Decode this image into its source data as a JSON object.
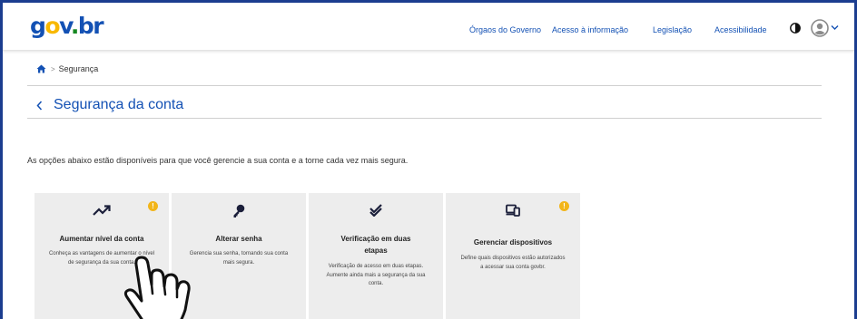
{
  "header": {
    "logo": {
      "g": "g",
      "o": "o",
      "v": "v",
      "dot": ".",
      "br": "br"
    },
    "nav": [
      {
        "label": "Órgaos do Governo"
      },
      {
        "label": "Acesso à informação"
      },
      {
        "label": "Legislação"
      },
      {
        "label": "Acessibilidade"
      }
    ],
    "icons": {
      "contrast": "contrast-icon",
      "avatar": "user-avatar-icon",
      "menu": "chevron-down-icon"
    }
  },
  "breadcrumb": {
    "current": "Segurança",
    "home_icon": "home-icon",
    "separator": ">"
  },
  "page": {
    "title": "Segurança da conta",
    "back_icon": "chevron-left-icon",
    "description": "As opções abaixo estão disponíveis para que você gerencie a sua conta e a torne cada vez mais segura."
  },
  "cards": [
    {
      "title": "Aumentar nível da conta",
      "description": "Conheça as vantagens de aumentar o nível de segurança da sua conta.",
      "icon": "trending-up-icon",
      "badge": "!"
    },
    {
      "title": "Alterar senha",
      "description": "Gerencia sua senha, tornando sua conta mais segura.",
      "icon": "key-icon"
    },
    {
      "title": "Verificação em duas etapas",
      "description": "Verificação de acesso em duas etapas. Aumente ainda mais a segurança da sua conta.",
      "icon": "double-check-icon"
    },
    {
      "title": "Gerenciar dispositivos",
      "description": "Define quais dispositivos estão autorizados a acessar sua conta govbr.",
      "icon": "devices-icon",
      "badge": "!"
    }
  ],
  "overlay": {
    "cursor": "hand-pointer-icon"
  },
  "colors": {
    "primary": "#1351b4",
    "warning": "#f2b51a",
    "card_bg": "#ededed"
  }
}
